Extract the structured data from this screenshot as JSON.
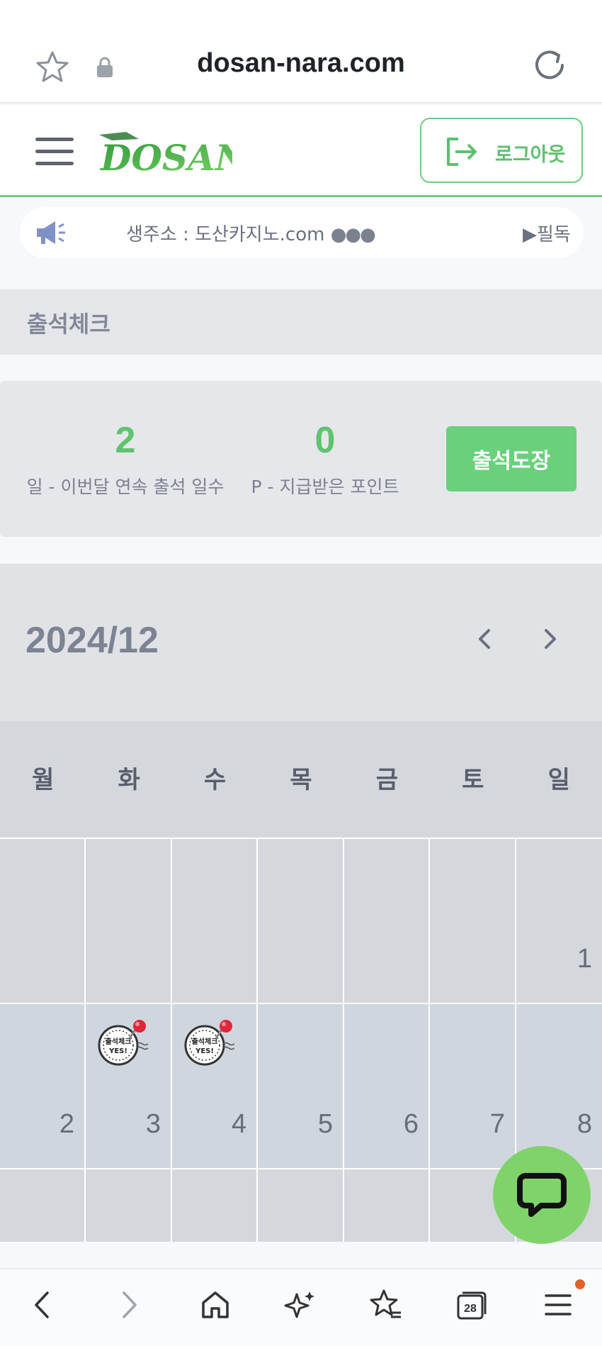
{
  "browser": {
    "domain": "dosan-nara.com"
  },
  "header": {
    "logo_text": "DOSAN",
    "logout_label": "로그아웃",
    "accent_color": "#6ccd7d"
  },
  "ticker": {
    "text": "생주소 : 도산카지노.com",
    "dots": "●●●",
    "right_text": "▶필독"
  },
  "attendance": {
    "title": "출석체크",
    "days_value": "2",
    "days_label": "일 - 이번달 연속 출석 일수",
    "points_value": "0",
    "points_label": "P - 지급받은 포인트",
    "stamp_button": "출석도장"
  },
  "calendar": {
    "month_label": "2024/12",
    "weekdays": [
      "월",
      "화",
      "수",
      "목",
      "금",
      "토",
      "일"
    ],
    "week1": [
      "",
      "",
      "",
      "",
      "",
      "",
      "1"
    ],
    "week2": [
      "2",
      "3",
      "4",
      "5",
      "6",
      "7",
      "8"
    ],
    "stamped_days": [
      "3",
      "4"
    ],
    "stamp_text_top": "출석체크",
    "stamp_text_bottom": "YES!"
  },
  "bottom_nav": {
    "tab_count": "28"
  }
}
